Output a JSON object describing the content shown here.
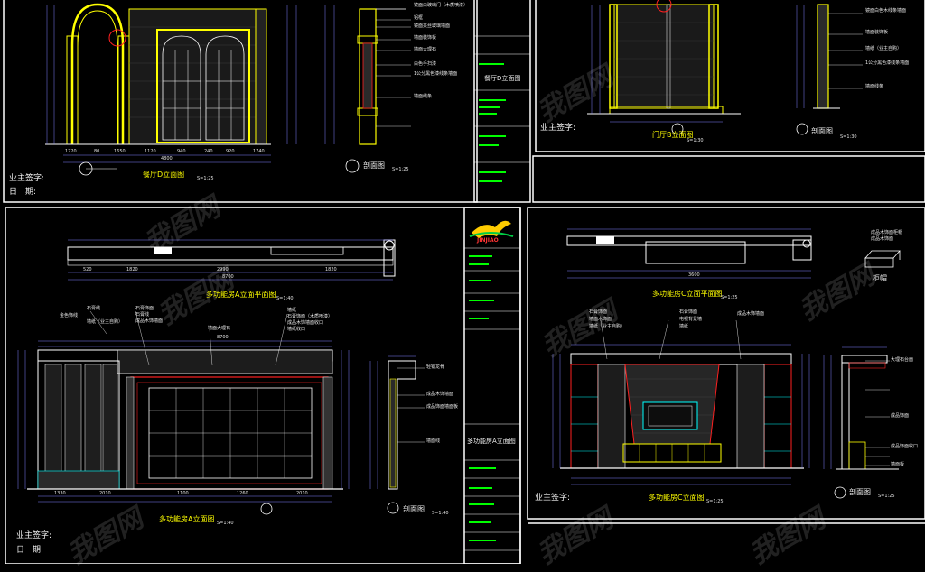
{
  "colors": {
    "background": "#000000",
    "frame": "#ffffff",
    "line_yellow": "#ffff00",
    "line_green": "#00ff00",
    "line_red": "#ff2020",
    "line_cyan": "#00ffff",
    "dim_blue": "#8080ff"
  },
  "sheet_top_left": {
    "title": "餐厅D立面图",
    "scale": "S=1:25",
    "section_title": "剖面图",
    "section_scale": "S=1:25",
    "owner_sign": "业主签字:",
    "date": "日　期:",
    "title_block_label": "餐厅D立面图",
    "callouts": [
      "镜面白玻璃门（木质喷漆）",
      "铝框",
      "镜面夹丝玻璃墙面",
      "墙面装饰板",
      "墙面大理石",
      "白色手扫漆",
      "1公分黑色漆线条墙面",
      "墙面线条"
    ]
  },
  "sheet_top_right": {
    "title": "门厅B立面图",
    "scale": "S=1:30",
    "section_title": "剖面图",
    "section_scale": "S=1:30",
    "owner_sign": "业主签字:",
    "callouts": [
      "镜面白色木线条墙面",
      "墙面装饰板",
      "墙纸（业主自购）",
      "1公分黑色漆线条墙面",
      "墙面线条"
    ]
  },
  "sheet_bottom_left": {
    "plan_title": "多功能房A立面平面图",
    "plan_scale": "S=1:40",
    "title": "多功能房A立面图",
    "scale": "S=1:40",
    "section_title": "剖面图",
    "section_scale": "S=1:40",
    "owner_sign": "业主签字:",
    "date": "日　期:",
    "logo_text": "JINJIAO",
    "title_block_label": "多功能房A立面图",
    "callouts_left": [
      "金色饰线",
      "石膏线",
      "墙纸（业主自购）"
    ],
    "callouts_mid": [
      "石膏饰面",
      "石膏线",
      "成品木饰墙面",
      "墙面大理石",
      "墙纸",
      "石膏饰面（木质喷漆）",
      "成品木饰墙面收口",
      "墙纸收口"
    ],
    "callouts_section": [
      "轻钢龙骨",
      "成品木饰墙面",
      "成品饰面墙面板",
      "墙面线"
    ]
  },
  "sheet_bottom_right": {
    "plan_title": "多功能房C立面平面图",
    "plan_scale": "S=1:25",
    "title": "多功能房C立面图",
    "scale": "S=1:25",
    "section_title": "剖面图",
    "section_scale": "S=1:25",
    "detail_title": "柜帽",
    "owner_sign": "业主签字:",
    "callouts": [
      "石膏饰面",
      "墙面木饰面",
      "墙纸（业主自购）",
      "石膏饰面",
      "电视背景墙",
      "墙纸",
      "成品木饰墙面",
      "大理石台面",
      "成品饰面",
      "成品饰面收口",
      "墙面板"
    ],
    "detail_callouts": [
      "成品木饰面柜帽",
      "成品木饰面"
    ]
  },
  "dims": {
    "top_left_bottom": [
      "1720",
      "80",
      "1650",
      "1120",
      "940",
      "240",
      "920",
      "1740"
    ],
    "top_left_total": "4800",
    "bottom_left_plan": [
      "520",
      "1820",
      "2990",
      "1820"
    ],
    "bottom_left_total": "8700",
    "bottom_left_elev": [
      "1330",
      "2010",
      "1100",
      "1260",
      "2010"
    ],
    "bottom_right_plan": "3600"
  },
  "watermark": "我图网"
}
